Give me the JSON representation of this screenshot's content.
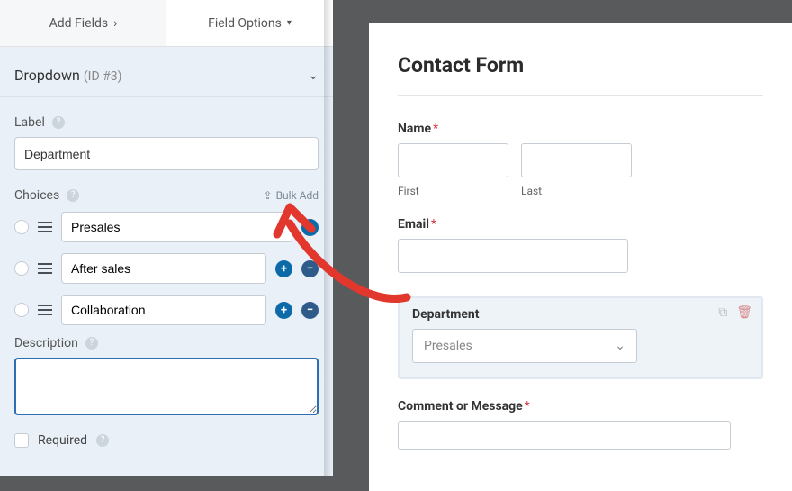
{
  "tabs": {
    "add_fields": "Add Fields",
    "field_options": "Field Options"
  },
  "section": {
    "title": "Dropdown",
    "id": "(ID #3)"
  },
  "labels": {
    "label_heading": "Label",
    "label_value": "Department",
    "choices_heading": "Choices",
    "bulk_add": "Bulk Add",
    "description_heading": "Description",
    "required_label": "Required"
  },
  "choices": [
    {
      "value": "Presales"
    },
    {
      "value": "After sales"
    },
    {
      "value": "Collaboration"
    }
  ],
  "preview": {
    "title": "Contact Form",
    "name_label": "Name",
    "name_first": "First",
    "name_last": "Last",
    "email_label": "Email",
    "department_label": "Department",
    "department_selected": "Presales",
    "comment_label": "Comment or Message"
  }
}
